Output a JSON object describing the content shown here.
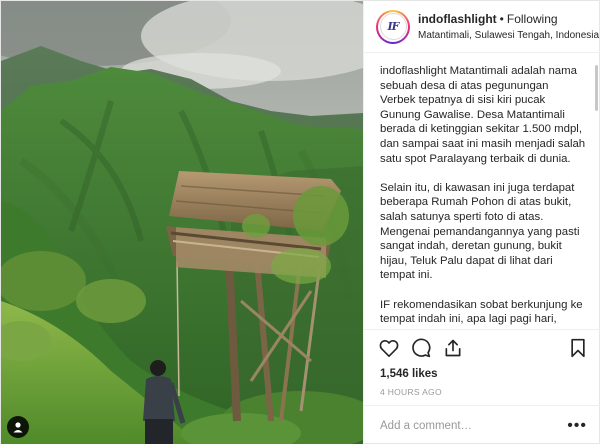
{
  "post": {
    "username": "indoflashlight",
    "separator": "•",
    "follow_status": "Following",
    "location": "Matantimali, Sulawesi Tengah, Indonesia",
    "avatar_text": "IF",
    "caption": {
      "username": "indoflashlight",
      "paragraph_1": "Matantimali adalah nama sebuah desa di atas pegunungan Verbek tepatnya di sisi kiri pucak Gunung Gawalise. Desa Matantimali berada di ketinggian sekitar 1.500 mdpl, dan sampai saat ini masih menjadi salah satu spot Paralayang terbaik di dunia.",
      "paragraph_2": "Selain itu, di kawasan ini juga terdapat beberapa Rumah Pohon di atas bukit, salah satunya sperti foto di atas. Mengenai pemandangannya yang pasti sangat indah, deretan gunung, bukit hijau, Teluk Palu dapat di lihat dari tempat ini.",
      "paragraph_3": "IF rekomendasikan sobat berkunjung ke tempat indah ini, apa lagi pagi hari, ketika sunrise mulai muncul maka akan terlihat sangat sempurna perpaduannya."
    },
    "likes": "1,546 likes",
    "time": "4 HOURS AGO",
    "comment_placeholder": "Add a comment…",
    "more_label": "•••",
    "icons": {
      "like": "heart-icon",
      "comment": "comment-icon",
      "share": "share-icon",
      "save": "bookmark-icon",
      "tag": "user-tag-icon"
    }
  }
}
